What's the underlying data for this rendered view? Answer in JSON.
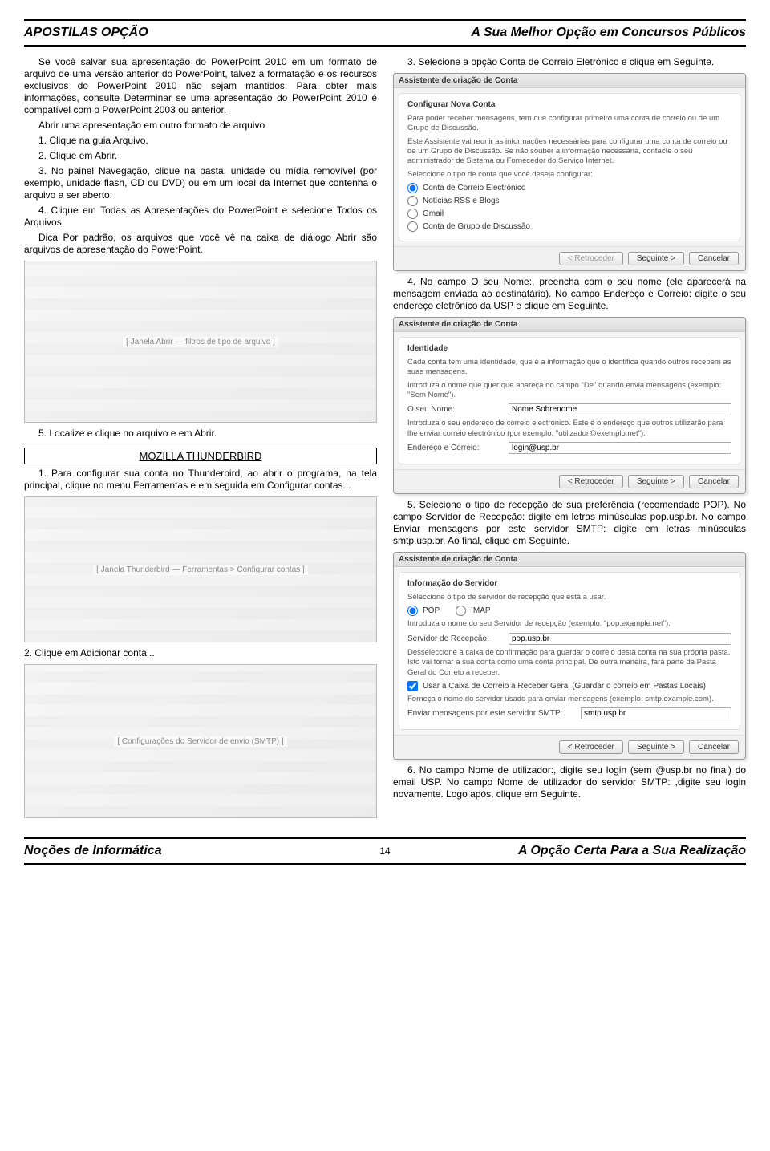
{
  "header": {
    "left": "APOSTILAS OPÇÃO",
    "right": "A Sua Melhor Opção em Concursos Públicos"
  },
  "footer": {
    "left": "Noções de Informática",
    "page": "14",
    "right": "A Opção Certa Para a Sua Realização"
  },
  "left": {
    "para1": "Se você salvar sua apresentação do PowerPoint 2010 em um formato de arquivo de uma versão anterior do PowerPoint, talvez a formatação e os recursos exclusivos do PowerPoint 2010 não sejam mantidos. Para obter mais informações, consulte Determinar se uma apresentação do PowerPoint 2010 é compatível com o PowerPoint 2003 ou anterior.",
    "heading_open": "Abrir uma apresentação em outro formato de arquivo",
    "step1": "1.      Clique na guia Arquivo.",
    "step2": "2.      Clique em Abrir.",
    "step3": "3.      No painel Navegação, clique na pasta, unidade ou mídia removível (por exemplo, unidade flash, CD ou DVD) ou em um local da Internet que contenha o arquivo a ser aberto.",
    "step4": "4.      Clique em Todas as Apresentações do PowerPoint e selecione Todos os Arquivos.",
    "tip": "Dica Por padrão, os arquivos que você vê na caixa de diálogo Abrir são arquivos de apresentação do PowerPoint.",
    "img_open_label": "[ Janela Abrir — filtros de tipo de arquivo ]",
    "step5": "5.        Localize e clique no arquivo e em Abrir.",
    "section_title": "MOZILLA THUNDERBIRD",
    "tb_step1": "1. Para configurar sua conta no Thunderbird, ao abrir o programa, na tela principal, clique no menu Ferramentas e em seguida em Configurar contas...",
    "img_tb_main": "[ Janela Thunderbird — Ferramentas > Configurar contas ]",
    "tb_step2": "2. Clique em Adicionar conta...",
    "img_tb_smtp": "[ Configurações do Servidor de envio (SMTP) ]"
  },
  "right": {
    "step3_intro": "3. Selecione a opção Conta de Correio Eletrônico e clique em Seguinte.",
    "dlg1": {
      "title": "Assistente de criação de Conta",
      "subhead": "Configurar Nova Conta",
      "note1": "Para poder receber mensagens, tem que configurar primeiro uma conta de correio ou de um Grupo de Discussão.",
      "note2": "Este Assistente vai reunir as informações necessárias para configurar uma conta de correio ou de um Grupo de Discussão. Se não souber a informação necessária, contacte o seu administrador de Sistema ou Fornecedor do Serviço Internet.",
      "note3": "Seleccione o tipo de conta que você deseja configurar:",
      "opt1": "Conta de Correio Electrónico",
      "opt2": "Notícias RSS e Blogs",
      "opt3": "Gmail",
      "opt4": "Conta de Grupo de Discussão",
      "back": "< Retroceder",
      "next": "Seguinte >",
      "cancel": "Cancelar"
    },
    "step4_intro": "4. No campo O seu Nome:, preencha com o seu nome (ele aparecerá na mensagem enviada ao destinatário). No campo Endereço e Correio: digite o seu endereço eletrônico da USP e clique em Seguinte.",
    "dlg2": {
      "title": "Assistente de criação de Conta",
      "subhead": "Identidade",
      "note1": "Cada conta tem uma identidade, que é a informação que o identifica quando outros recebem as suas mensagens.",
      "note2": "Introduza o nome que quer que apareça no campo \"De\" quando envia mensagens (exemplo: \"Sem Nome\").",
      "name_label": "O seu Nome:",
      "name_value": "Nome Sobrenome",
      "note3": "Introduza o seu endereço de correio electrónico. Este é o endereço que outros utilizarão para lhe enviar correio electrónico (por exemplo, \"utilizador@exemplo.net\").",
      "mail_label": "Endereço e Correio:",
      "mail_value": "login@usp.br",
      "back": "< Retroceder",
      "next": "Seguinte >",
      "cancel": "Cancelar"
    },
    "step5_intro": "5. Selecione o tipo de recepção de sua preferência (recomendado POP). No campo Servidor de Recepção: digite em letras minúsculas pop.usp.br. No campo Enviar mensagens por este servidor SMTP: digite em letras minúsculas smtp.usp.br. Ao final, clique em Seguinte.",
    "dlg3": {
      "title": "Assistente de criação de Conta",
      "subhead": "Informação do Servidor",
      "note1": "Seleccione o tipo de servidor de recepção que está a usar.",
      "opt_pop": "POP",
      "opt_imap": "IMAP",
      "note2": "Introduza o nome do seu Servidor de recepção (exemplo: \"pop.example.net\").",
      "recv_label": "Servidor de Recepção:",
      "recv_value": "pop.usp.br",
      "note3": "Desseleccione a caixa de confirmação para guardar o correio desta conta na sua própria pasta. Isto vai tornar a sua conta como uma conta principal. De outra maneira, fará parte da Pasta Geral do Correio a receber.",
      "check_label": "Usar a Caixa de Correio a Receber Geral (Guardar o correio em Pastas Locais)",
      "note4": "Forneça o nome do servidor usado para enviar mensagens (exemplo: smtp.example.com).",
      "smtp_label": "Enviar mensagens por este servidor SMTP:",
      "smtp_value": "smtp.usp.br",
      "back": "< Retroceder",
      "next": "Seguinte >",
      "cancel": "Cancelar"
    },
    "step6_intro": "6. No campo Nome de utilizador:, digite seu login (sem @usp.br no final) do email USP. No campo Nome de utilizador do servidor SMTP: ,digite seu login novamente. Logo após, clique em Seguinte."
  }
}
